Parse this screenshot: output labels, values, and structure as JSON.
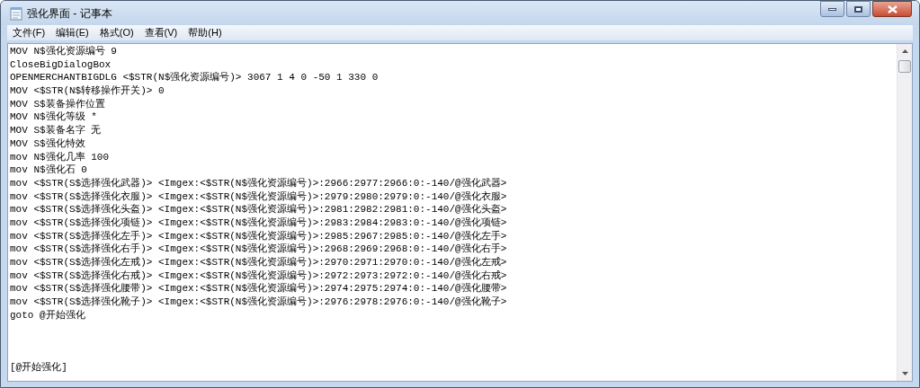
{
  "window": {
    "title": "强化界面 - 记事本"
  },
  "menu": [
    "文件(F)",
    "编辑(E)",
    "格式(O)",
    "查看(V)",
    "帮助(H)"
  ],
  "editor": {
    "blocks": [
      {
        "lines": [
          "MOV N$强化资源编号 9",
          "CloseBigDialogBox",
          "OPENMERCHANTBIGDLG <$STR(N$强化资源编号)> 3067 1 4 0 -50 1 330 0",
          "MOV <$STR(N$转移操作开关)> 0",
          "MOV S$装备操作位置",
          "MOV N$强化等级 *",
          "MOV S$装备名字 无",
          "MOV S$强化特效",
          "mov N$强化几率 100",
          "mov N$强化石 0",
          "mov <$STR(S$选择强化武器)> <Imgex:<$STR(N$强化资源编号)>:2966:2977:2966:0:-140/@强化武器>",
          "mov <$STR(S$选择强化衣服)> <Imgex:<$STR(N$强化资源编号)>:2979:2980:2979:0:-140/@强化衣服>",
          "mov <$STR(S$选择强化头盔)> <Imgex:<$STR(N$强化资源编号)>:2981:2982:2981:0:-140/@强化头盔>",
          "mov <$STR(S$选择强化项链)> <Imgex:<$STR(N$强化资源编号)>:2983:2984:2983:0:-140/@强化项链>",
          "mov <$STR(S$选择强化左手)> <Imgex:<$STR(N$强化资源编号)>:2985:2967:2985:0:-140/@强化左手>",
          "mov <$STR(S$选择强化右手)> <Imgex:<$STR(N$强化资源编号)>:2968:2969:2968:0:-140/@强化右手>",
          "mov <$STR(S$选择强化左戒)> <Imgex:<$STR(N$强化资源编号)>:2970:2971:2970:0:-140/@强化左戒>",
          "mov <$STR(S$选择强化右戒)> <Imgex:<$STR(N$强化资源编号)>:2972:2973:2972:0:-140/@强化右戒>",
          "mov <$STR(S$选择强化腰带)> <Imgex:<$STR(N$强化资源编号)>:2974:2975:2974:0:-140/@强化腰带>",
          "mov <$STR(S$选择强化靴子)> <Imgex:<$STR(N$强化资源编号)>:2976:2978:2976:0:-140/@强化靴子>",
          "goto @开始强化"
        ]
      },
      {
        "lines": [
          "[@开始强化]"
        ]
      }
    ]
  }
}
